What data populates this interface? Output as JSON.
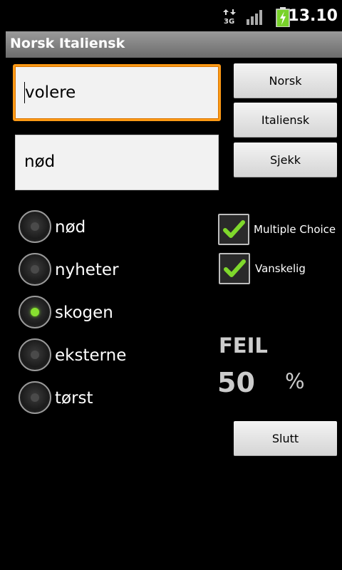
{
  "status_bar": {
    "time": "13.10",
    "network_label": "3G"
  },
  "title_bar": {
    "title": "Norsk Italiensk"
  },
  "inputs": {
    "word_value": "volere",
    "answer_value": "nød"
  },
  "buttons": {
    "norsk": "Norsk",
    "italiensk": "Italiensk",
    "sjekk": "Sjekk",
    "slutt": "Slutt"
  },
  "options": [
    {
      "label": "nød",
      "checked": false
    },
    {
      "label": "nyheter",
      "checked": false
    },
    {
      "label": "skogen",
      "checked": true
    },
    {
      "label": "eksterne",
      "checked": false
    },
    {
      "label": "tørst",
      "checked": false
    }
  ],
  "checkboxes": [
    {
      "label": "Multiple Choice",
      "checked": true
    },
    {
      "label": "Vanskelig",
      "checked": true
    }
  ],
  "score": {
    "label": "FEIL",
    "value": "50",
    "unit": "%"
  },
  "colors": {
    "focus_border": "#ff9a16",
    "checked_radio": "#88e030",
    "check_mark": "#7fd82c"
  }
}
